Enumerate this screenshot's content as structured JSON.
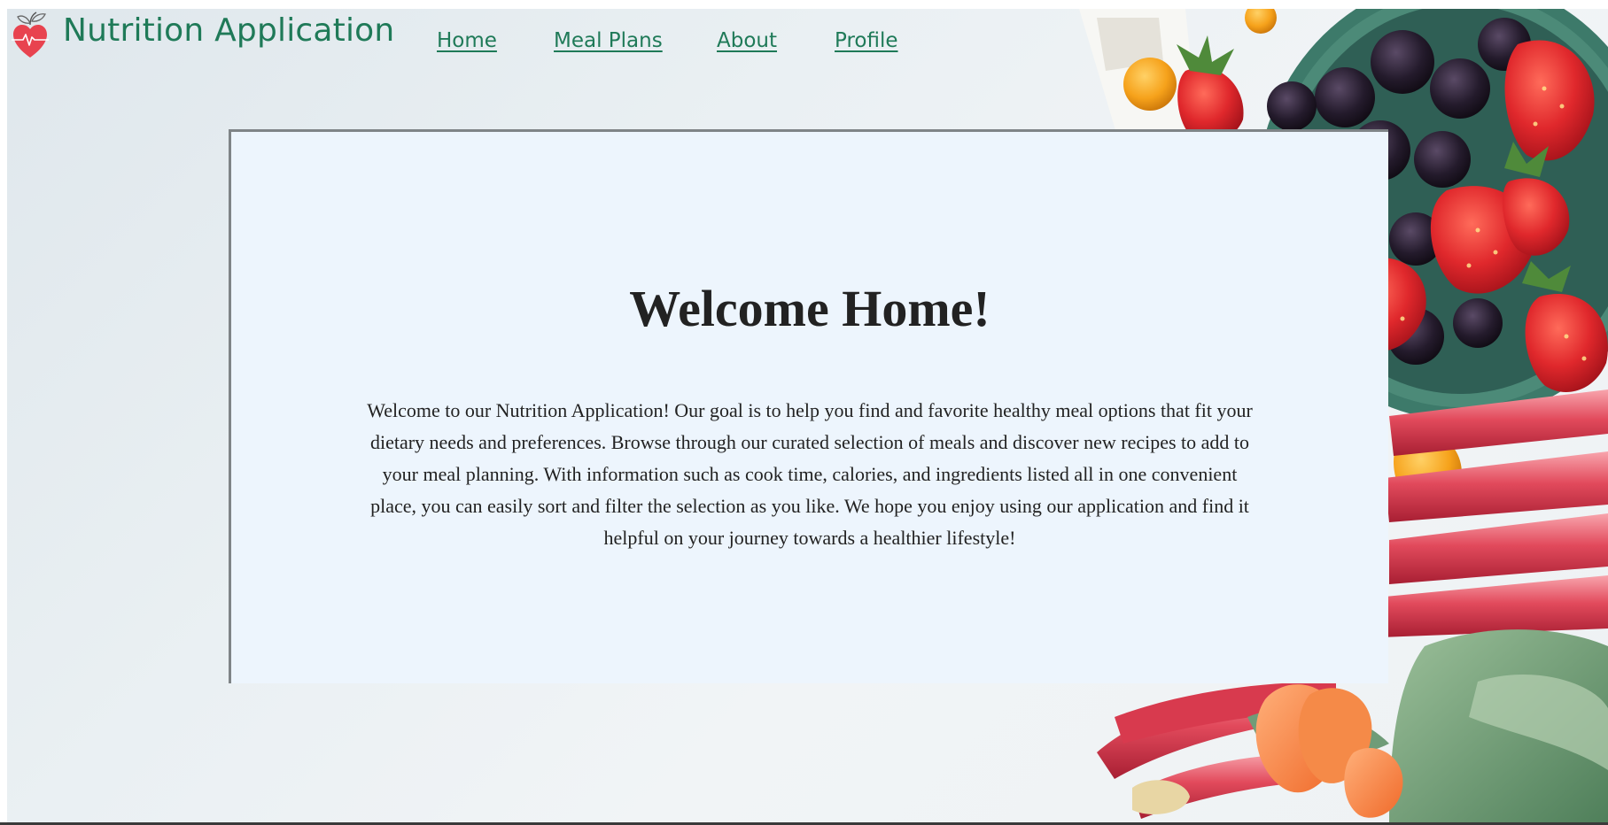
{
  "header": {
    "logo_icon": "heart-leaf-icon",
    "title": "Nutrition Application",
    "nav": [
      {
        "label": "Home"
      },
      {
        "label": "Meal Plans"
      },
      {
        "label": "About"
      },
      {
        "label": "Profile"
      }
    ]
  },
  "main": {
    "heading": "Welcome Home!",
    "body": "Welcome to our Nutrition Application! Our goal is to help you find and favorite healthy meal options that fit your dietary needs and preferences. Browse through our curated selection of meals and discover new recipes to add to your meal planning. With information such as cook time, calories, and ingredients listed all in one convenient place, you can easily sort and filter the selection as you like. We hope you enjoy using our application and find it helpful on your journey towards a healthier lifestyle!"
  },
  "colors": {
    "brand": "#1f7a58",
    "card_bg": "#edf5fd",
    "text": "#222222",
    "heart": "#e8434f"
  }
}
